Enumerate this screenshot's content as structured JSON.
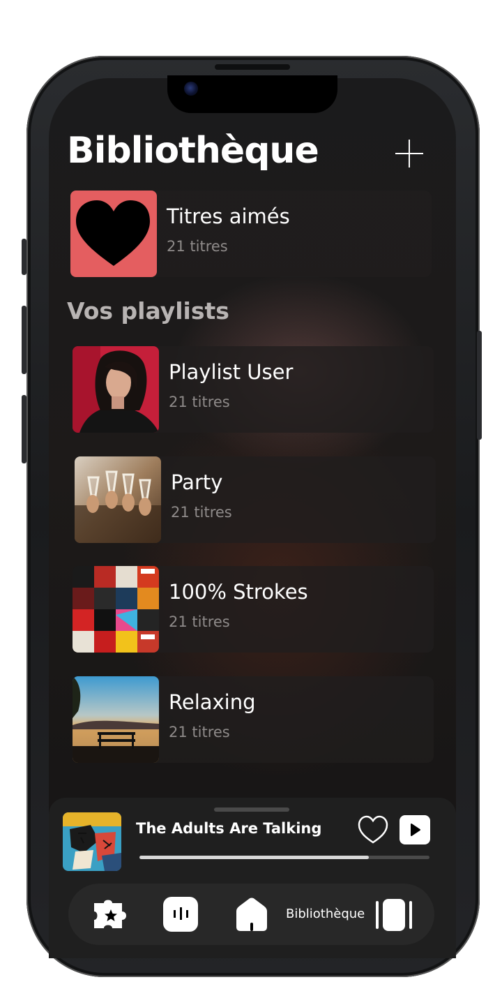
{
  "header": {
    "title": "Bibliothèque",
    "add_icon": "plus-icon"
  },
  "liked": {
    "title": "Titres aimés",
    "subtitle": "21 titres",
    "icon": "heart-icon",
    "color": "#e45e60"
  },
  "section": {
    "title": "Vos playlists"
  },
  "playlists": [
    {
      "title": "Playlist User",
      "subtitle": "21 titres"
    },
    {
      "title": "Party",
      "subtitle": "21 titres"
    },
    {
      "title": "100% Strokes",
      "subtitle": "21 titres"
    },
    {
      "title": "Relaxing",
      "subtitle": "21 titres"
    }
  ],
  "player": {
    "track_title": "The Adults Are Talking",
    "progress": 0.79,
    "like_icon": "heart-outline-icon",
    "play_icon": "play-icon"
  },
  "nav": {
    "items": [
      {
        "icon": "puzzle-star-icon"
      },
      {
        "icon": "equalizer-icon"
      },
      {
        "icon": "home-icon"
      },
      {
        "icon": "library-icon",
        "label": "Bibliothèque",
        "active": true
      }
    ]
  },
  "colors": {
    "background": "#1b1b1c",
    "card": "#201e1e",
    "accent_liked": "#e45e60",
    "text_muted": "#8f8b8a"
  }
}
